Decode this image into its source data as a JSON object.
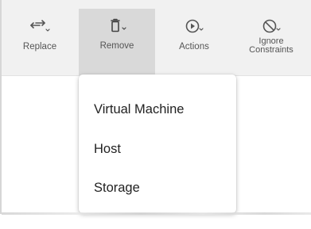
{
  "toolbar": {
    "replace_label": "Replace",
    "remove_label": "Remove",
    "actions_label": "Actions",
    "ignore_constraints_label_line1": "Ignore",
    "ignore_constraints_label_line2": "Constraints"
  },
  "dropdown": {
    "items": [
      {
        "label": "Virtual Machine"
      },
      {
        "label": "Host"
      },
      {
        "label": "Storage"
      }
    ]
  },
  "icons": {
    "replace": "swap-arrows-icon",
    "remove": "trash-icon",
    "actions": "play-circle-icon",
    "ignore_constraints": "no-entry-icon",
    "dropdown_caret": "chevron-down-icon"
  },
  "colors": {
    "toolbar_bg": "#f1f1f1",
    "active_button_bg": "#d9d9d9",
    "menu_bg": "#ffffff",
    "text": "#222222",
    "icon": "#555555"
  }
}
